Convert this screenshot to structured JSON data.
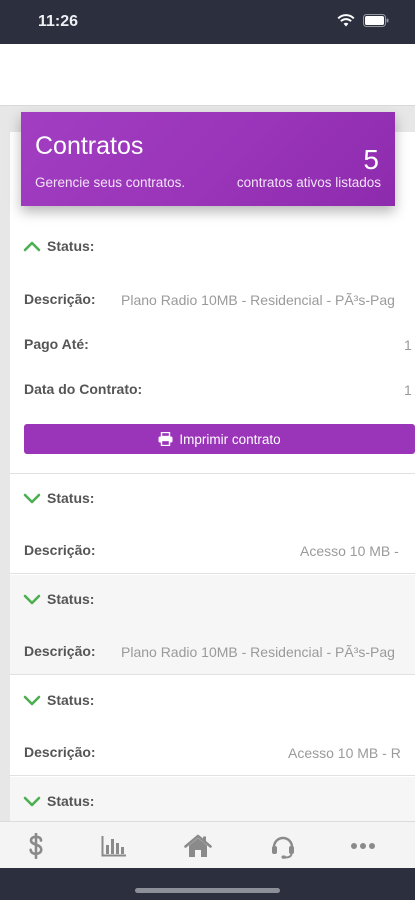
{
  "status_bar": {
    "time": "11:26"
  },
  "header": {
    "title": "Contratos",
    "subtitle": "Gerencie seus contratos.",
    "count": "5",
    "count_label": "contratos ativos listados"
  },
  "labels": {
    "status": "Status:",
    "descricao": "Descrição:",
    "pago_ate": "Pago Até:",
    "data_contrato": "Data do Contrato:"
  },
  "contracts": [
    {
      "expanded": true,
      "descricao": "Plano Radio 10MB - Residencial - PÃ³s-Pag",
      "pago_ate": "1",
      "data_contrato": "1",
      "print_label": "Imprimir contrato"
    },
    {
      "expanded": false,
      "descricao": "Acesso 10 MB -"
    },
    {
      "expanded": false,
      "descricao": "Plano Radio 10MB - Residencial - PÃ³s-Pag"
    },
    {
      "expanded": false,
      "descricao": "Acesso 10 MB - R"
    },
    {
      "expanded": false
    }
  ],
  "tabs": [
    {
      "icon": "dollar-icon"
    },
    {
      "icon": "bar-chart-icon"
    },
    {
      "icon": "home-icon"
    },
    {
      "icon": "headset-icon"
    },
    {
      "icon": "more-icon"
    }
  ],
  "colors": {
    "accent": "#9a34b9",
    "chevron": "#4caf50",
    "status_bar": "#2b2f3e"
  }
}
